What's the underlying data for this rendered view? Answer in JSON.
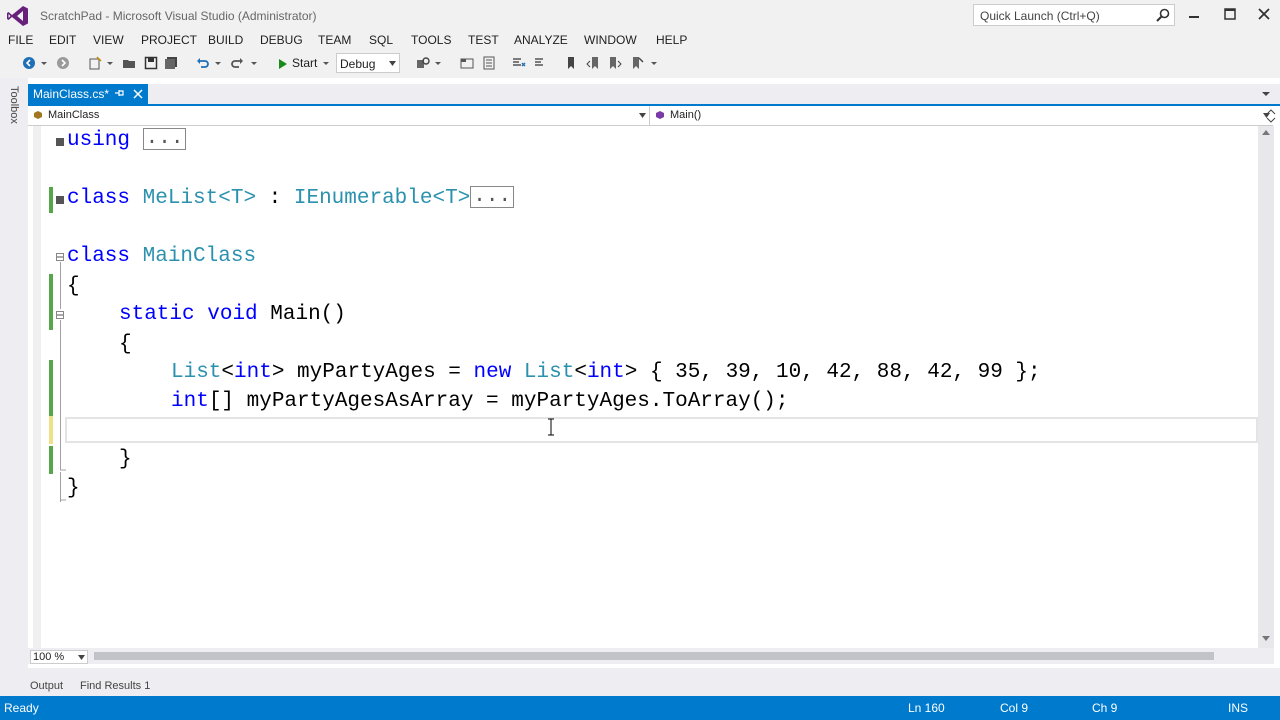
{
  "window": {
    "title": "ScratchPad - Microsoft Visual Studio (Administrator)",
    "quick_launch_placeholder": "Quick Launch (Ctrl+Q)"
  },
  "menu": [
    "FILE",
    "EDIT",
    "VIEW",
    "PROJECT",
    "BUILD",
    "DEBUG",
    "TEAM",
    "SQL",
    "TOOLS",
    "TEST",
    "ANALYZE",
    "WINDOW",
    "HELP"
  ],
  "toolbar": {
    "start_label": "Start",
    "configuration": "Debug"
  },
  "toolbox_label": "Toolbox",
  "tab": {
    "label": "MainClass.cs*"
  },
  "navbar": {
    "class_combo": "MainClass",
    "member_combo": "Main()"
  },
  "code": {
    "line1_keyword": "using",
    "collapsed": "...",
    "line2_kw": "class",
    "line2_name": "MeList<T>",
    "line2_colon": " : ",
    "line2_iface": "IEnumerable<T>",
    "line3_kw": "class",
    "line3_name": "MainClass",
    "brace_open": "{",
    "brace_close": "}",
    "main_static": "static",
    "main_void": "void",
    "main_sig": "Main()",
    "list_type_a": "List",
    "list_lt": "<",
    "list_int": "int",
    "list_gt": ">",
    "list_var": " myPartyAges = ",
    "list_new": "new",
    "list_init": "{ 35, 39, 10, 42, 88, 42, 99 };",
    "arr_int": "int",
    "arr_rest": "[] myPartyAgesAsArray = myPartyAges.ToArray();"
  },
  "zoom": "100 %",
  "panel_tabs": [
    "Output",
    "Find Results 1"
  ],
  "status": {
    "state": "Ready",
    "line": "Ln 160",
    "col": "Col 9",
    "ch": "Ch 9",
    "mode": "INS"
  },
  "colors": {
    "accent": "#007acc",
    "keyword": "#0000ff",
    "type": "#2b91af"
  }
}
